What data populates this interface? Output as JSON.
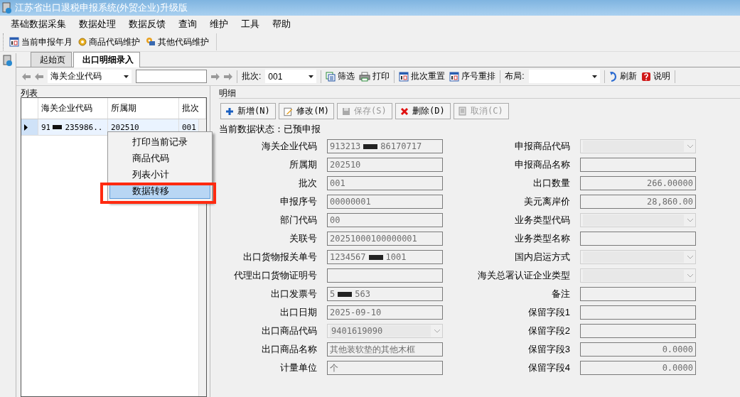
{
  "window": {
    "title": "江苏省出口退税申报系统(外贸企业)升级版"
  },
  "menu": [
    "基础数据采集",
    "数据处理",
    "数据反馈",
    "查询",
    "维护",
    "工具",
    "帮助"
  ],
  "quick_toolbar": [
    "当前申报年月",
    "商品代码维护",
    "其他代码维护"
  ],
  "tabs": [
    {
      "label": "起始页",
      "selected": false
    },
    {
      "label": "出口明细录入",
      "selected": true
    }
  ],
  "toolbar": {
    "filter_field": "海关企业代码",
    "batch_label": "批次:",
    "batch_value": "001",
    "buttons1": [
      "筛选",
      "打印"
    ],
    "buttons2": [
      "批次重置",
      "序号重排"
    ],
    "layout_label": "布局:",
    "buttons3": [
      "刷新",
      "说明"
    ]
  },
  "list": {
    "title": "列表",
    "columns": [
      "海关企业代码",
      "所属期",
      "批次"
    ],
    "rows": [
      {
        "cells": [
          [
            "91",
            "235986..."
          ],
          [
            "202510"
          ],
          [
            "001"
          ]
        ],
        "selected": true
      }
    ]
  },
  "context_menu": [
    {
      "label": "打印当前记录",
      "selected": false,
      "annotated": false
    },
    {
      "label": "商品代码",
      "selected": false,
      "annotated": false
    },
    {
      "label": "列表小计",
      "selected": false,
      "annotated": false
    },
    {
      "label": "数据转移",
      "selected": true,
      "annotated": true
    }
  ],
  "detail": {
    "title": "明细",
    "buttons": [
      {
        "label": "新增(N)",
        "disabled": false
      },
      {
        "label": "修改(M)",
        "disabled": false
      },
      {
        "label": "保存(S)",
        "disabled": true
      },
      {
        "label": "删除(D)",
        "disabled": false
      },
      {
        "label": "取消(C)",
        "disabled": true
      }
    ],
    "status": "当前数据状态：已预申报",
    "left_fields": [
      {
        "label": "海关企业代码",
        "kind": "text",
        "value": [
          "913213",
          "86170717"
        ]
      },
      {
        "label": "所属期",
        "kind": "text",
        "value": [
          "202510"
        ]
      },
      {
        "label": "批次",
        "kind": "text",
        "value": [
          "001"
        ]
      },
      {
        "label": "申报序号",
        "kind": "text",
        "value": [
          "00000001"
        ]
      },
      {
        "label": "部门代码",
        "kind": "text",
        "value": [
          "00"
        ]
      },
      {
        "label": "关联号",
        "kind": "text",
        "value": [
          "20251000100000001"
        ]
      },
      {
        "label": "出口货物报关单号",
        "kind": "text",
        "value": [
          "1234567",
          "1001"
        ]
      },
      {
        "label": "代理出口货物证明号",
        "kind": "text"
      },
      {
        "label": "出口发票号",
        "kind": "text",
        "value": [
          "5",
          "563"
        ]
      },
      {
        "label": "出口日期",
        "kind": "text",
        "value": [
          "2025-09-10"
        ]
      },
      {
        "label": "出口商品代码",
        "kind": "dropdown",
        "value": [
          "9401619090"
        ]
      },
      {
        "label": "出口商品名称",
        "kind": "text",
        "value": [
          "其他装软垫的其他木框"
        ]
      },
      {
        "label": "计量单位",
        "kind": "text",
        "value": [
          "个"
        ]
      }
    ],
    "right_fields": [
      {
        "label": "申报商品代码",
        "kind": "dropdown"
      },
      {
        "label": "申报商品名称",
        "kind": "text"
      },
      {
        "label": "出口数量",
        "kind": "number",
        "value": [
          "266.00000"
        ]
      },
      {
        "label": "美元离岸价",
        "kind": "number",
        "value": [
          "28,860.00"
        ]
      },
      {
        "label": "业务类型代码",
        "kind": "dropdown"
      },
      {
        "label": "业务类型名称",
        "kind": "text"
      },
      {
        "label": "国内启运方式",
        "kind": "dropdown"
      },
      {
        "label": "海关总署认证企业类型",
        "kind": "dropdown"
      },
      {
        "label": "备注",
        "kind": "text"
      },
      {
        "label": "保留字段1",
        "kind": "text"
      },
      {
        "label": "保留字段2",
        "kind": "text"
      },
      {
        "label": "保留字段3",
        "kind": "number",
        "value": [
          "0.0000"
        ]
      },
      {
        "label": "保留字段4",
        "kind": "number",
        "value": [
          "0.0000"
        ]
      }
    ]
  }
}
